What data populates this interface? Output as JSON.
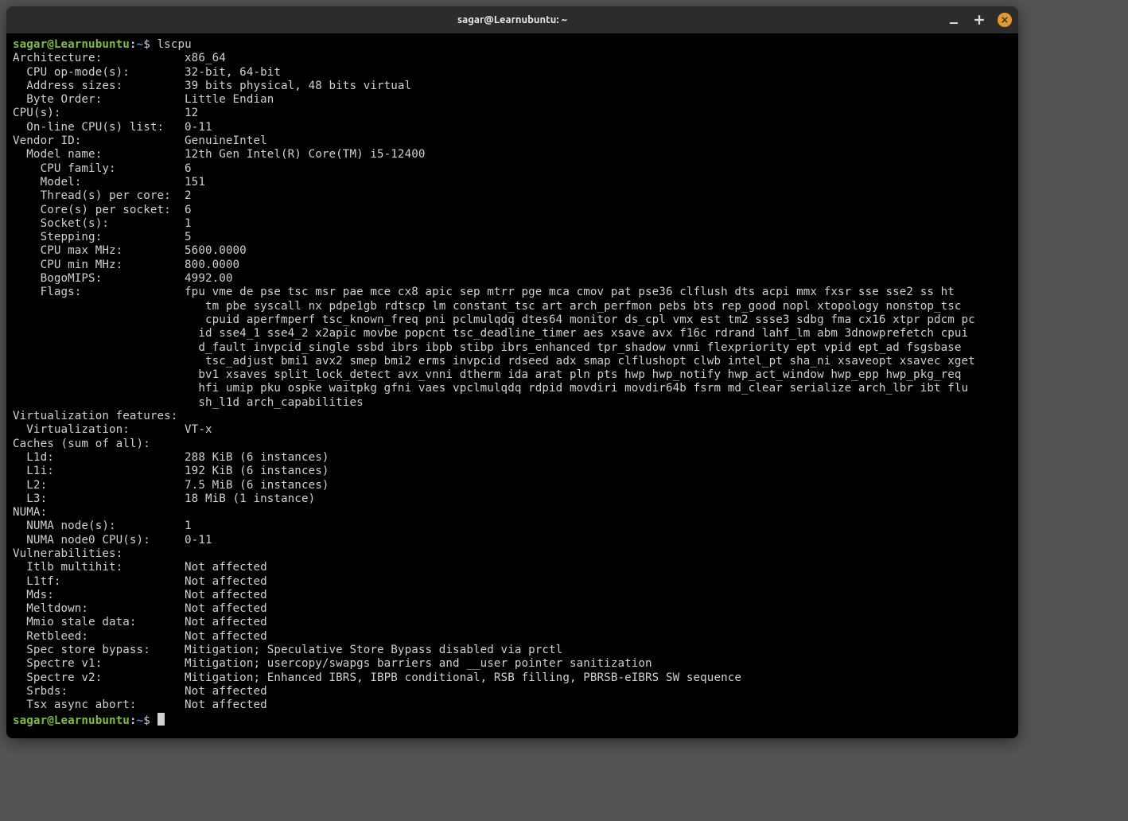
{
  "window": {
    "title": "sagar@Learnubuntu: ~"
  },
  "prompt": {
    "user_host": "sagar@Learnubuntu",
    "sep": ":",
    "path": "~",
    "dollar": "$ "
  },
  "command": "lscpu",
  "output": {
    "rows": [
      {
        "indent": 0,
        "label": "Architecture:",
        "value": "x86_64"
      },
      {
        "indent": 1,
        "label": "CPU op-mode(s):",
        "value": "32-bit, 64-bit"
      },
      {
        "indent": 1,
        "label": "Address sizes:",
        "value": "39 bits physical, 48 bits virtual"
      },
      {
        "indent": 1,
        "label": "Byte Order:",
        "value": "Little Endian"
      },
      {
        "indent": 0,
        "label": "CPU(s):",
        "value": "12"
      },
      {
        "indent": 1,
        "label": "On-line CPU(s) list:",
        "value": "0-11"
      },
      {
        "indent": 0,
        "label": "Vendor ID:",
        "value": "GenuineIntel"
      },
      {
        "indent": 1,
        "label": "Model name:",
        "value": "12th Gen Intel(R) Core(TM) i5-12400"
      },
      {
        "indent": 2,
        "label": "CPU family:",
        "value": "6"
      },
      {
        "indent": 2,
        "label": "Model:",
        "value": "151"
      },
      {
        "indent": 2,
        "label": "Thread(s) per core:",
        "value": "2"
      },
      {
        "indent": 2,
        "label": "Core(s) per socket:",
        "value": "6"
      },
      {
        "indent": 2,
        "label": "Socket(s):",
        "value": "1"
      },
      {
        "indent": 2,
        "label": "Stepping:",
        "value": "5"
      },
      {
        "indent": 2,
        "label": "CPU max MHz:",
        "value": "5600.0000"
      },
      {
        "indent": 2,
        "label": "CPU min MHz:",
        "value": "800.0000"
      },
      {
        "indent": 2,
        "label": "BogoMIPS:",
        "value": "4992.00"
      },
      {
        "indent": 2,
        "label": "Flags:",
        "value": "fpu vme de pse tsc msr pae mce cx8 apic sep mtrr pge mca cmov pat pse36 clflush dts acpi mmx fxsr sse sse2 ss ht"
      }
    ],
    "flags_cont": [
      " tm pbe syscall nx pdpe1gb rdtscp lm constant_tsc art arch_perfmon pebs bts rep_good nopl xtopology nonstop_tsc",
      " cpuid aperfmperf tsc_known_freq pni pclmulqdq dtes64 monitor ds_cpl vmx est tm2 ssse3 sdbg fma cx16 xtpr pdcm pc",
      "id sse4_1 sse4_2 x2apic movbe popcnt tsc_deadline_timer aes xsave avx f16c rdrand lahf_lm abm 3dnowprefetch cpui",
      "d_fault invpcid_single ssbd ibrs ibpb stibp ibrs_enhanced tpr_shadow vnmi flexpriority ept vpid ept_ad fsgsbase",
      " tsc_adjust bmi1 avx2 smep bmi2 erms invpcid rdseed adx smap clflushopt clwb intel_pt sha_ni xsaveopt xsavec xget",
      "bv1 xsaves split_lock_detect avx_vnni dtherm ida arat pln pts hwp hwp_notify hwp_act_window hwp_epp hwp_pkg_req ",
      "hfi umip pku ospke waitpkg gfni vaes vpclmulqdq rdpid movdiri movdir64b fsrm md_clear serialize arch_lbr ibt flu",
      "sh_l1d arch_capabilities"
    ],
    "rows2": [
      {
        "indent": 0,
        "label": "Virtualization features:",
        "value": ""
      },
      {
        "indent": 1,
        "label": "Virtualization:",
        "value": "VT-x"
      },
      {
        "indent": 0,
        "label": "Caches (sum of all):",
        "value": ""
      },
      {
        "indent": 1,
        "label": "L1d:",
        "value": "288 KiB (6 instances)"
      },
      {
        "indent": 1,
        "label": "L1i:",
        "value": "192 KiB (6 instances)"
      },
      {
        "indent": 1,
        "label": "L2:",
        "value": "7.5 MiB (6 instances)"
      },
      {
        "indent": 1,
        "label": "L3:",
        "value": "18 MiB (1 instance)"
      },
      {
        "indent": 0,
        "label": "NUMA:",
        "value": ""
      },
      {
        "indent": 1,
        "label": "NUMA node(s):",
        "value": "1"
      },
      {
        "indent": 1,
        "label": "NUMA node0 CPU(s):",
        "value": "0-11"
      },
      {
        "indent": 0,
        "label": "Vulnerabilities:",
        "value": ""
      },
      {
        "indent": 1,
        "label": "Itlb multihit:",
        "value": "Not affected"
      },
      {
        "indent": 1,
        "label": "L1tf:",
        "value": "Not affected"
      },
      {
        "indent": 1,
        "label": "Mds:",
        "value": "Not affected"
      },
      {
        "indent": 1,
        "label": "Meltdown:",
        "value": "Not affected"
      },
      {
        "indent": 1,
        "label": "Mmio stale data:",
        "value": "Not affected"
      },
      {
        "indent": 1,
        "label": "Retbleed:",
        "value": "Not affected"
      },
      {
        "indent": 1,
        "label": "Spec store bypass:",
        "value": "Mitigation; Speculative Store Bypass disabled via prctl"
      },
      {
        "indent": 1,
        "label": "Spectre v1:",
        "value": "Mitigation; usercopy/swapgs barriers and __user pointer sanitization"
      },
      {
        "indent": 1,
        "label": "Spectre v2:",
        "value": "Mitigation; Enhanced IBRS, IBPB conditional, RSB filling, PBRSB-eIBRS SW sequence"
      },
      {
        "indent": 1,
        "label": "Srbds:",
        "value": "Not affected"
      },
      {
        "indent": 1,
        "label": "Tsx async abort:",
        "value": "Not affected"
      }
    ],
    "label_col": 25,
    "flags_indent": 27
  }
}
